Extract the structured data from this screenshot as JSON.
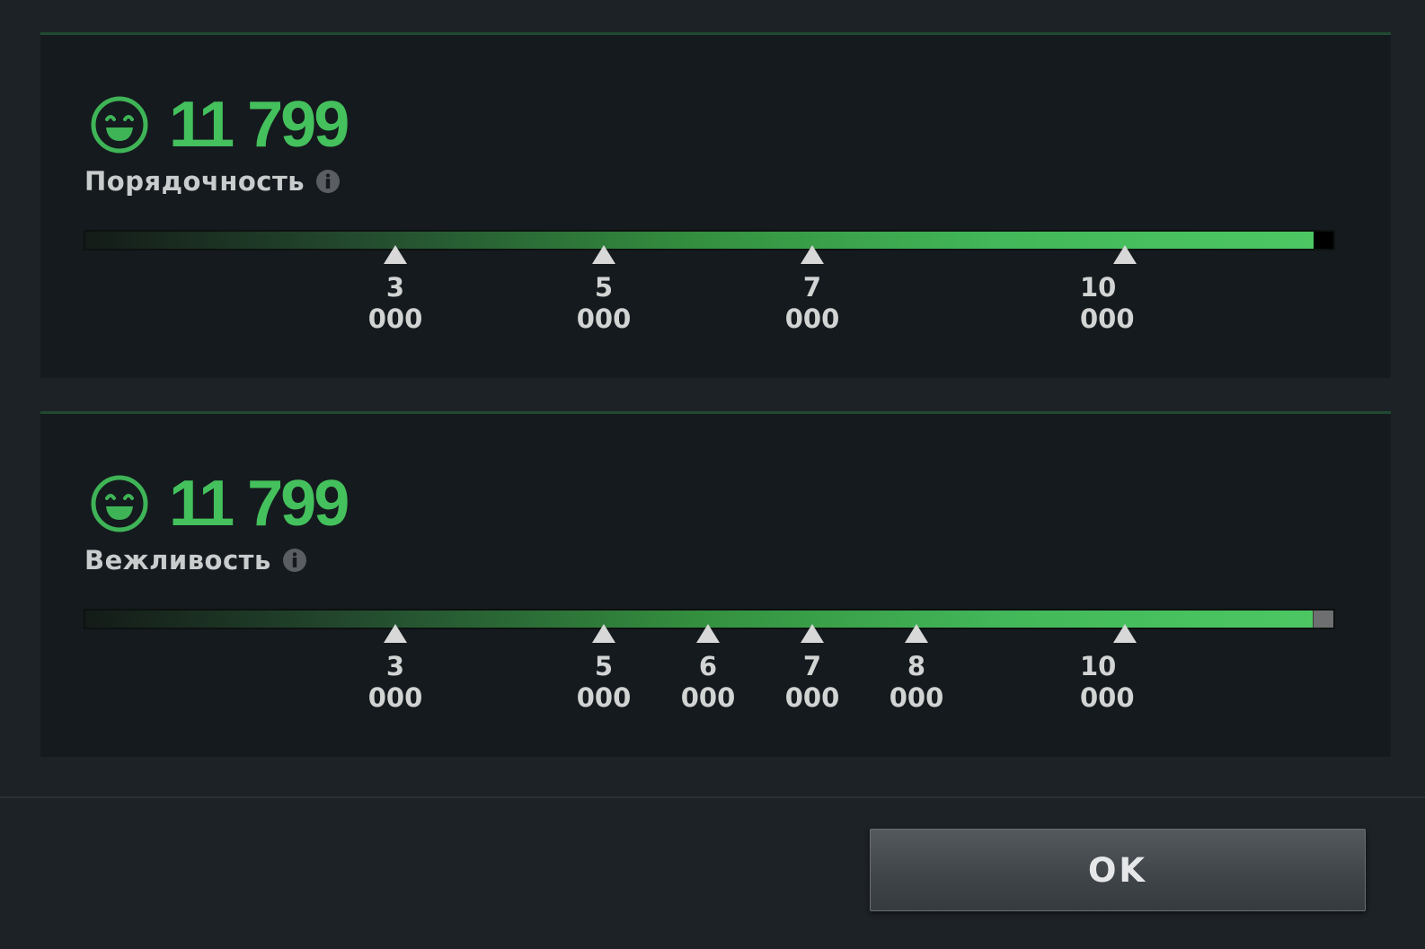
{
  "colors": {
    "accent": "#44c05c",
    "panel_bg": "#151a1e",
    "page_bg": "#1d2226",
    "label": "#c9cccd"
  },
  "panels": [
    {
      "icon": "smiley-face-icon",
      "score": "11 799",
      "label": "Порядочность",
      "info_icon": "info-icon",
      "progress_fraction": 0.985,
      "end_cap": "black",
      "ticks": [
        {
          "value": 3000,
          "label": "3 000"
        },
        {
          "value": 5000,
          "label": "5 000"
        },
        {
          "value": 7000,
          "label": "7 000"
        },
        {
          "value": 10000,
          "label": "10 000"
        }
      ]
    },
    {
      "icon": "smiley-face-icon",
      "score": "11 799",
      "label": "Вежливость",
      "info_icon": "info-icon",
      "progress_fraction": 0.985,
      "end_cap": "grey",
      "ticks": [
        {
          "value": 3000,
          "label": "3 000"
        },
        {
          "value": 5000,
          "label": "5 000"
        },
        {
          "value": 6000,
          "label": "6 000"
        },
        {
          "value": 7000,
          "label": "7 000"
        },
        {
          "value": 8000,
          "label": "8 000"
        },
        {
          "value": 10000,
          "label": "10 000"
        }
      ]
    }
  ],
  "footer": {
    "ok_label": "OK"
  }
}
